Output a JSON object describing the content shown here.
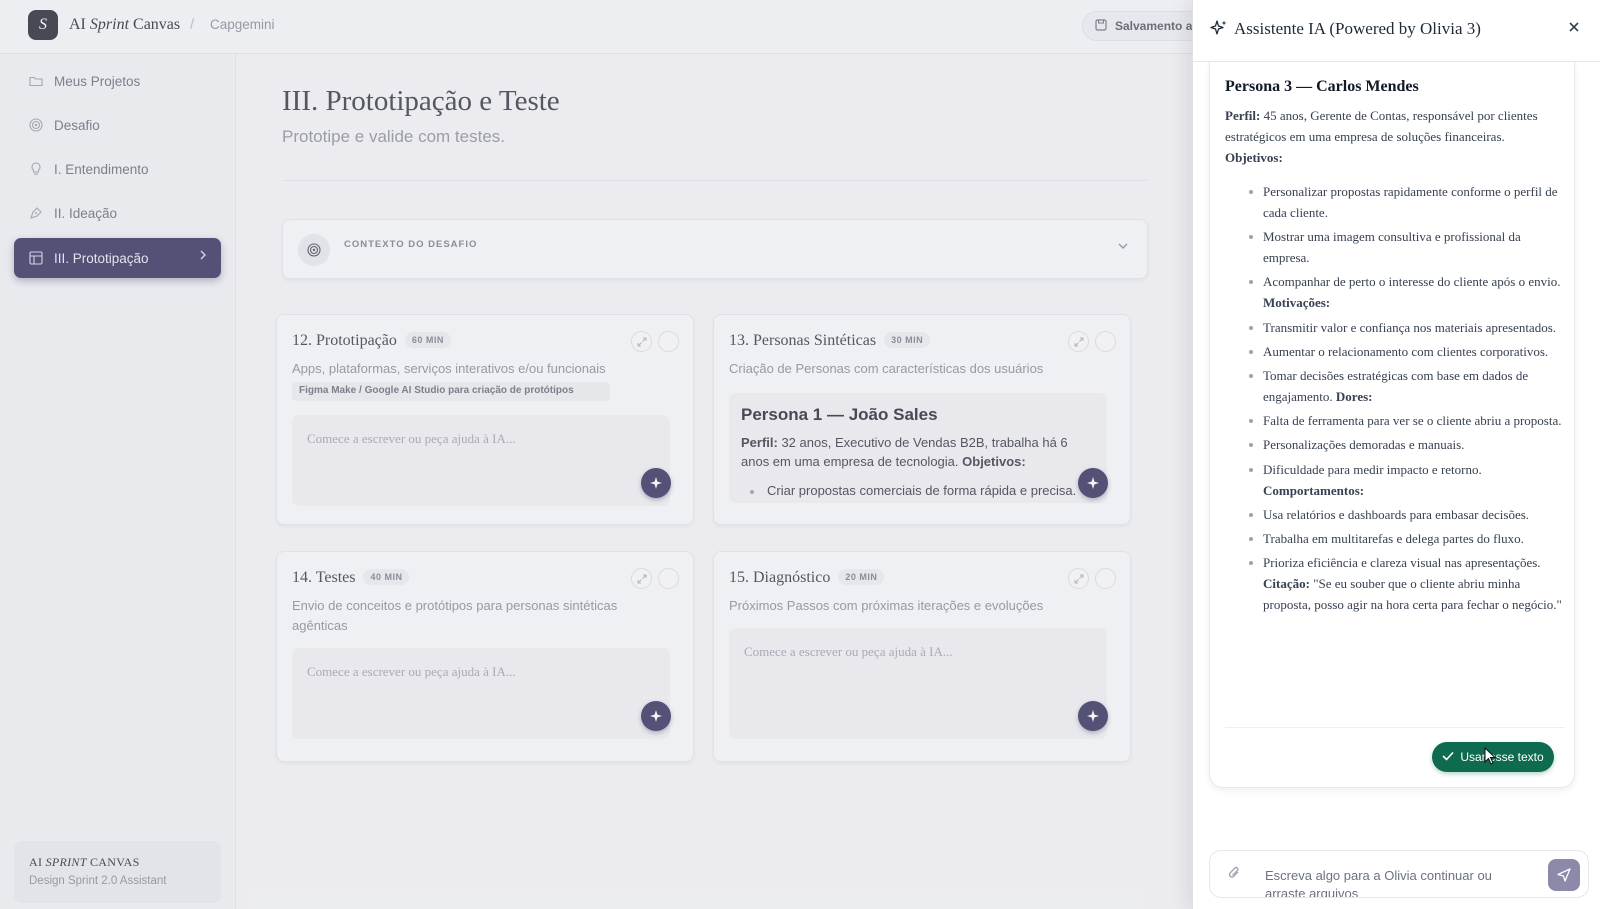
{
  "topbar": {
    "logo_letter": "S",
    "app_title_prefix": "AI ",
    "app_title_italic": "Sprint",
    "app_title_suffix": " Canvas",
    "separator": "/",
    "breadcrumb": "Capgemini",
    "save_label": "Salvamento au"
  },
  "sidebar": {
    "items": [
      {
        "label": "Meus Projetos",
        "icon": "folder-icon"
      },
      {
        "label": "Desafio",
        "icon": "target-icon"
      },
      {
        "label": "I. Entendimento",
        "icon": "lightbulb-icon"
      },
      {
        "label": "II. Ideação",
        "icon": "pen-tool-icon"
      },
      {
        "label": "III. Prototipação",
        "icon": "layout-icon",
        "active": true
      }
    ],
    "footer_title_prefix": "AI ",
    "footer_title_italic": "SPRINT",
    "footer_title_suffix": " CANVAS",
    "footer_subtitle": "Design Sprint 2.0 Assistant"
  },
  "main": {
    "title": "III. Prototipação e Teste",
    "subtitle": "Prototipe e valide com testes.",
    "context_label": "CONTEXTO DO DESAFIO",
    "cards": [
      {
        "title": "12. Prototipação",
        "badge": "60 MIN",
        "description": "Apps, plataformas, serviços interativos e/ou funcionais",
        "tag": "Figma Make / Google AI Studio para criação de protótipos",
        "placeholder": "Comece a escrever ou peça ajuda à IA..."
      },
      {
        "title": "13. Personas Sintéticas",
        "badge": "30 MIN",
        "description": "Criação de Personas com características dos usuários",
        "persona_heading": "Persona 1 — João Sales",
        "persona_profile_label": "Perfil:",
        "persona_profile_text": " 32 anos, Executivo de Vendas B2B, trabalha há 6 anos em uma empresa de tecnologia. ",
        "persona_objectives_label": "Objetivos:",
        "persona_item": "Criar propostas comerciais de forma rápida e precisa."
      },
      {
        "title": "14. Testes",
        "badge": "40 MIN",
        "description": "Envio de conceitos e protótipos para personas sintéticas agênticas",
        "placeholder": "Comece a escrever ou peça ajuda à IA..."
      },
      {
        "title": "15. Diagnóstico",
        "badge": "20 MIN",
        "description": "Próximos Passos com próximas iterações e evoluções",
        "placeholder": "Comece a escrever ou peça ajuda à IA..."
      }
    ]
  },
  "assistant": {
    "title": "Assistente IA (Powered by Olivia 3)",
    "close": "×",
    "persona_heading": "Persona 3 — Carlos Mendes",
    "profile_label": "Perfil:",
    "profile_text": " 45 anos, Gerente de Contas, responsável por clientes estratégicos em uma empresa de soluções financeiras. ",
    "objectives_label": "Objetivos:",
    "items": [
      {
        "text": "Personalizar propostas rapidamente conforme o perfil de cada cliente.",
        "bold": ""
      },
      {
        "text": "Mostrar uma imagem consultiva e profissional da empresa.",
        "bold": ""
      },
      {
        "text": "Acompanhar de perto o interesse do cliente após o envio. ",
        "bold": "Motivações:"
      },
      {
        "text": "Transmitir valor e confiança nos materiais apresentados.",
        "bold": ""
      },
      {
        "text": "Aumentar o relacionamento com clientes corporativos.",
        "bold": ""
      },
      {
        "text": "Tomar decisões estratégicas com base em dados de engajamento. ",
        "bold": "Dores:"
      },
      {
        "text": "Falta de ferramenta para ver se o cliente abriu a proposta.",
        "bold": ""
      },
      {
        "text": "Personalizações demoradas e manuais.",
        "bold": ""
      },
      {
        "text": "Dificuldade para medir impacto e retorno.",
        "bold": ""
      },
      {
        "text": "",
        "bold": "Comportamentos:"
      },
      {
        "text": "Usa relatórios e dashboards para embasar decisões.",
        "bold": ""
      },
      {
        "text": "Trabalha em multitarefas e delega partes do fluxo.",
        "bold": ""
      },
      {
        "text": "Prioriza eficiência e clareza visual nas apresentações. ",
        "bold": "Citação:",
        "after": " \"Se eu souber que o cliente abriu minha proposta, posso agir na hora certa para fechar o negócio.\""
      }
    ],
    "use_text_label": "Usar esse texto",
    "composer_placeholder": "Escreva algo para a Olivia continuar ou arraste arquivos"
  }
}
